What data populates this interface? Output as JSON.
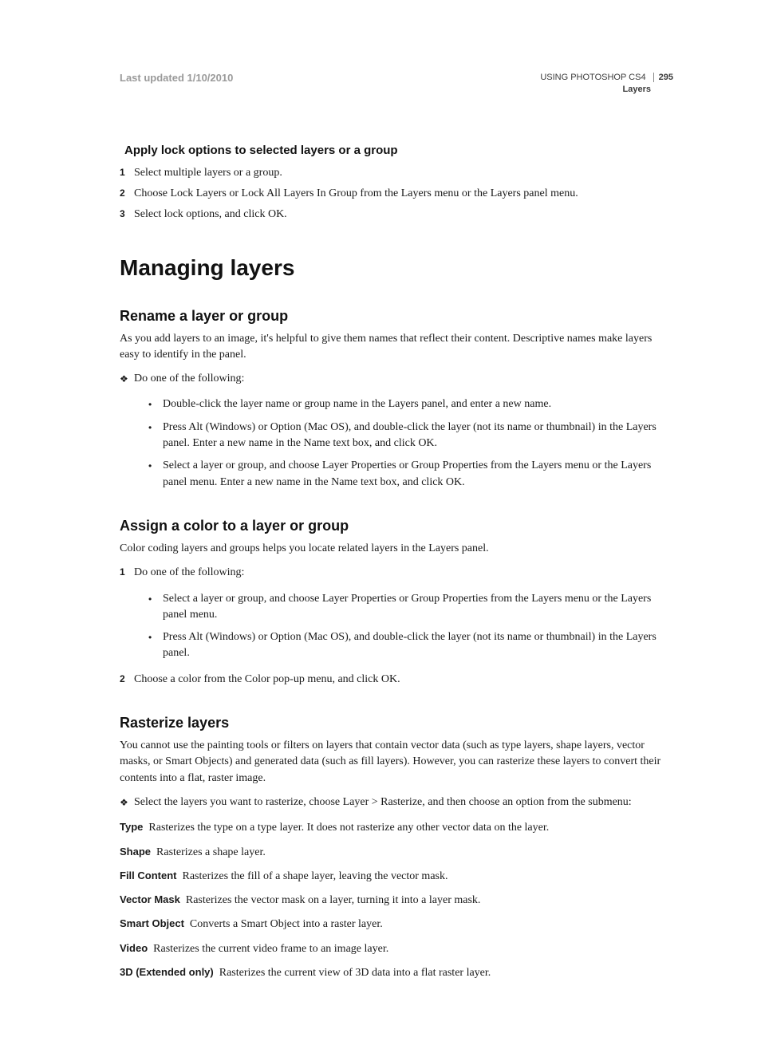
{
  "header": {
    "last_updated": "Last updated 1/10/2010",
    "book_title": "USING PHOTOSHOP CS4",
    "page_number": "295",
    "section": "Layers"
  },
  "s1": {
    "heading": "Apply lock options to selected layers or a group",
    "steps": [
      "Select multiple layers or a group.",
      "Choose Lock Layers or Lock All Layers In Group from the Layers menu or the Layers panel menu.",
      "Select lock options, and click OK."
    ]
  },
  "chapter": "Managing layers",
  "s2": {
    "heading": "Rename a layer or group",
    "intro": "As you add layers to an image, it's helpful to give them names that reflect their content. Descriptive names make layers easy to identify in the panel.",
    "lead": "Do one of the following:",
    "bullets": [
      "Double-click the layer name or group name in the Layers panel, and enter a new name.",
      "Press Alt (Windows) or Option (Mac OS), and double-click the layer (not its name or thumbnail) in the Layers panel. Enter a new name in the Name text box, and click OK.",
      "Select a layer or group, and choose Layer Properties or Group Properties from the Layers menu or the Layers panel menu. Enter a new name in the Name text box, and click OK."
    ]
  },
  "s3": {
    "heading": "Assign a color to a layer or group",
    "intro": "Color coding layers and groups helps you locate related layers in the Layers panel.",
    "step1": "Do one of the following:",
    "bullets": [
      "Select a layer or group, and choose Layer Properties or Group Properties from the Layers menu or the Layers panel menu.",
      "Press Alt (Windows) or Option (Mac OS), and double-click the layer (not its name or thumbnail) in the Layers panel."
    ],
    "step2": "Choose a color from the Color pop-up menu, and click OK."
  },
  "s4": {
    "heading": "Rasterize layers",
    "intro": "You cannot use the painting tools or filters on layers that contain vector data (such as type layers, shape layers, vector masks, or Smart Objects) and generated data (such as fill layers). However, you can rasterize these layers to convert their contents into a flat, raster image.",
    "lead": "Select the layers you want to rasterize, choose Layer > Rasterize, and then choose an option from the submenu:",
    "defs": [
      {
        "term": "Type",
        "def": "Rasterizes the type on a type layer. It does not rasterize any other vector data on the layer."
      },
      {
        "term": "Shape",
        "def": "Rasterizes a shape layer."
      },
      {
        "term": "Fill Content",
        "def": "Rasterizes the fill of a shape layer, leaving the vector mask."
      },
      {
        "term": "Vector Mask",
        "def": "Rasterizes the vector mask on a layer, turning it into a layer mask."
      },
      {
        "term": "Smart Object",
        "def": "Converts a Smart Object into a raster layer."
      },
      {
        "term": "Video",
        "def": "Rasterizes the current video frame to an image layer."
      },
      {
        "term": "3D (Extended only)",
        "def": "Rasterizes the current view of 3D data into a flat raster layer."
      }
    ]
  }
}
